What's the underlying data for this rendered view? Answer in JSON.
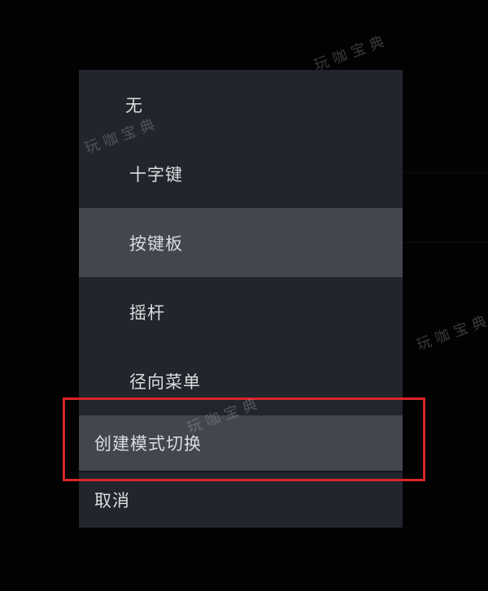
{
  "menu": {
    "items": [
      {
        "label": "无"
      },
      {
        "label": "十字键"
      },
      {
        "label": "按键板"
      },
      {
        "label": "摇杆"
      },
      {
        "label": "径向菜单"
      },
      {
        "label": "创建模式切换"
      },
      {
        "label": "取消"
      }
    ],
    "selected_index": 2
  },
  "watermark": {
    "text": "玩咖宝典"
  },
  "colors": {
    "menu_background": "#23252c",
    "highlighted_item": "#43464f",
    "annotation_box": "#d8252a",
    "text": "#dcdde1"
  }
}
